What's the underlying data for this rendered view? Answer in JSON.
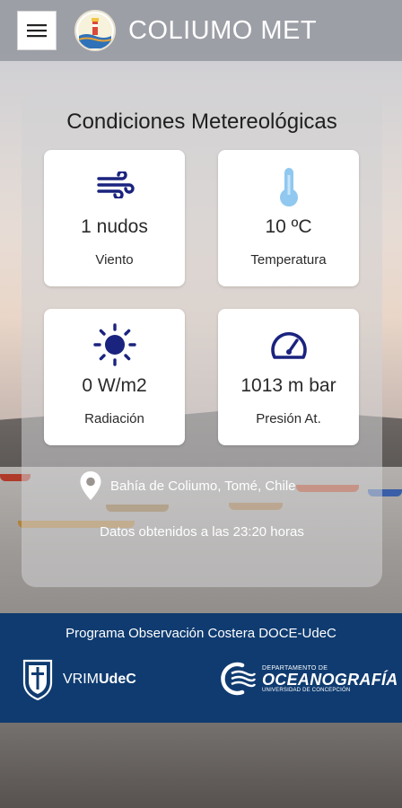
{
  "header": {
    "title": "COLIUMO MET",
    "menu_icon": "hamburger-menu-icon",
    "logo_icon": "lighthouse-logo"
  },
  "panel": {
    "title": "Condiciones Metereológicas",
    "cards": [
      {
        "icon": "wind-icon",
        "value": "1 nudos",
        "label": "Viento"
      },
      {
        "icon": "thermometer-icon",
        "value": "10 ºC",
        "label": "Temperatura"
      },
      {
        "icon": "sun-icon",
        "value": "0 W/m2",
        "label": "Radiación"
      },
      {
        "icon": "gauge-icon",
        "value": "1013 m bar",
        "label": "Presión At."
      }
    ],
    "location": "Bahía de Coliumo, Tomé, Chile",
    "timestamp": "Datos obtenidos a las 23:20 horas"
  },
  "footer": {
    "title": "Programa Observación Costera DOCE-UdeC",
    "vrim_prefix": "VRIM",
    "vrim_suffix": "UdeC",
    "ocean_top": "DEPARTAMENTO DE",
    "ocean_main": "OCEANOGRAFÍA",
    "ocean_sub": "UNIVERSIDAD DE CONCEPCIÓN"
  },
  "colors": {
    "accent": "#1a237e",
    "thermo": "#90c8f0",
    "footer_bg": "#0f3b70"
  }
}
